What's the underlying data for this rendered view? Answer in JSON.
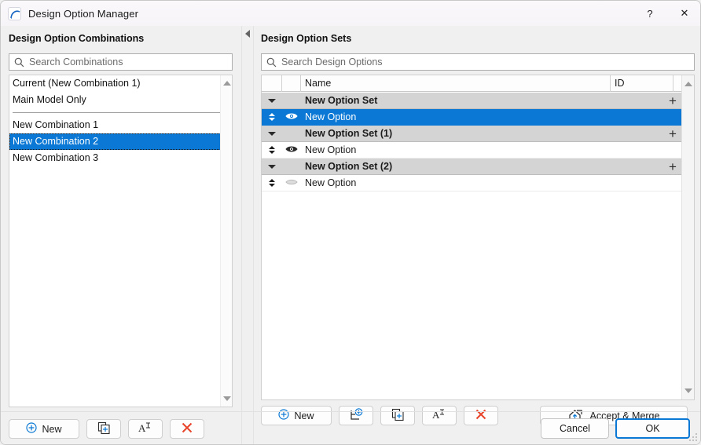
{
  "window": {
    "title": "Design Option Manager",
    "app_icon": "archicad-arc-icon",
    "help_label": "?",
    "close_label": "✕"
  },
  "left_panel": {
    "title": "Design Option Combinations",
    "search": {
      "placeholder": "Search Combinations",
      "value": "",
      "icon": "search-icon"
    },
    "items": [
      {
        "label": "Current (New Combination 1)",
        "selected": false,
        "separator_after": false
      },
      {
        "label": "Main Model Only",
        "selected": false,
        "separator_after": true
      },
      {
        "label": "New Combination 1",
        "selected": false,
        "separator_after": false
      },
      {
        "label": "New Combination 2",
        "selected": true,
        "separator_after": false
      },
      {
        "label": "New Combination 3",
        "selected": false,
        "separator_after": false
      }
    ],
    "toolbar": {
      "new_label": "New",
      "new_icon": "circle-plus-icon",
      "duplicate_icon": "duplicate-plus-icon",
      "rename_icon": "rename-text-icon",
      "delete_icon": "red-x-icon"
    },
    "scrollbar": {
      "up_icon": "triangle-up-icon",
      "down_icon": "triangle-down-icon"
    }
  },
  "splitter": {
    "collapse_icon": "triangle-left-icon"
  },
  "right_panel": {
    "title": "Design Option Sets",
    "search": {
      "placeholder": "Search Design Options",
      "value": "",
      "icon": "search-icon"
    },
    "columns": [
      {
        "key": "c0",
        "label": ""
      },
      {
        "key": "c1",
        "label": ""
      },
      {
        "key": "name",
        "label": "Name"
      },
      {
        "key": "id",
        "label": "ID"
      },
      {
        "key": "cx",
        "label": ""
      }
    ],
    "rows": [
      {
        "type": "set",
        "name": "New Option Set",
        "id": "",
        "selected": false,
        "expanded": true,
        "expand_icon": "caret-down-icon",
        "add_icon": "plus-icon"
      },
      {
        "type": "option",
        "name": "New Option",
        "id": "",
        "selected": true,
        "reorder_icon": "updown-arrows-icon",
        "visibility": "visible",
        "eye_icon": "eye-visible-icon"
      },
      {
        "type": "set",
        "name": "New Option Set (1)",
        "id": "",
        "selected": false,
        "expanded": true,
        "expand_icon": "caret-down-icon",
        "add_icon": "plus-icon"
      },
      {
        "type": "option",
        "name": "New Option",
        "id": "",
        "selected": false,
        "reorder_icon": "updown-arrows-icon",
        "visibility": "visible",
        "eye_icon": "eye-visible-icon"
      },
      {
        "type": "set",
        "name": "New Option Set (2)",
        "id": "",
        "selected": false,
        "expanded": true,
        "expand_icon": "caret-down-icon",
        "add_icon": "plus-icon"
      },
      {
        "type": "option",
        "name": "New Option",
        "id": "",
        "selected": false,
        "reorder_icon": "updown-arrows-icon",
        "visibility": "hidden",
        "eye_icon": "eye-hidden-icon"
      }
    ],
    "toolbar": {
      "new_label": "New",
      "new_icon": "circle-plus-icon",
      "new_set_icon": "new-option-set-icon",
      "duplicate_icon": "duplicate-plus-icon",
      "rename_icon": "rename-text-icon",
      "delete_icon": "red-x-icon",
      "accept_merge_label": "Accept & Merge",
      "accept_merge_icon": "house-upload-icon"
    },
    "scrollbar": {
      "up_icon": "triangle-up-icon",
      "down_icon": "triangle-down-icon"
    }
  },
  "footer": {
    "cancel_label": "Cancel",
    "ok_label": "OK",
    "resize_grip": "resize-grip-icon"
  },
  "colors": {
    "accent": "#0a78d4",
    "selection": "#0a78d4",
    "set_row_bg": "#d4d4d4",
    "delete_red": "#e8452c",
    "window_bg": "#f0f0f0"
  }
}
